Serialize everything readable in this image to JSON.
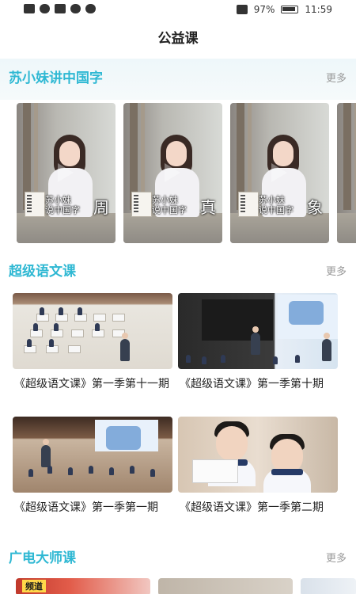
{
  "status_bar": {
    "battery": "97%",
    "time": "11:59"
  },
  "header": {
    "title": "公益课"
  },
  "sections": [
    {
      "title": "苏小妹讲中国字",
      "more": "更多"
    },
    {
      "title": "超级语文课",
      "more": "更多"
    },
    {
      "title": "广电大师课",
      "more": "更多"
    }
  ],
  "su_xiaomei": {
    "caption_line1": "苏小妹",
    "caption_line2": "说中国字",
    "videos": [
      {
        "char": "周"
      },
      {
        "char": "真"
      },
      {
        "char": "象"
      }
    ]
  },
  "lessons": [
    {
      "title": "《超级语文课》第一季第十一期"
    },
    {
      "title": "《超级语文课》第一季第十期"
    },
    {
      "title": "《超级语文课》第一季第一期"
    },
    {
      "title": "《超级语文课》第一季第二期"
    }
  ],
  "bottom_row": {
    "tag": "频道"
  },
  "colors": {
    "section_title": "#2fb8d3",
    "more": "#999999"
  }
}
